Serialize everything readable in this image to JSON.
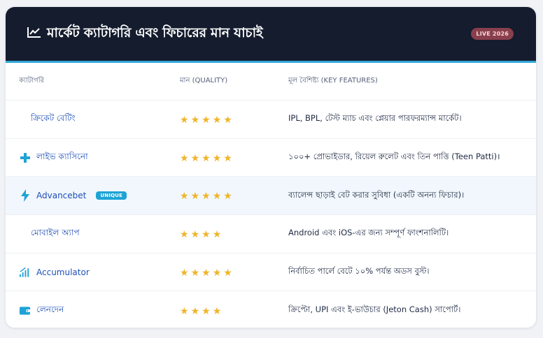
{
  "header": {
    "title": "মার্কেট ক্যাটাগরি এবং ফিচারের মান যাচাই",
    "badge": "LIVE 2026"
  },
  "columns": {
    "category": "ক্যাটাগরি",
    "quality": "মান (QUALITY)",
    "features": "মূল বৈশিষ্ট্য (KEY FEATURES)"
  },
  "rows": [
    {
      "category": "ক্রিকেট বেটিং",
      "icon": "none",
      "stars": 5,
      "feature": "IPL, BPL, টেস্ট ম্যাচ এবং প্লেয়ার পারফরম্যান্স মার্কেট।"
    },
    {
      "category": "লাইভ ক্যাসিনো",
      "icon": "plus-icon",
      "stars": 5,
      "feature": "১০০+ প্রোভাইডার, রিয়েল রুলেট এবং তিন পাত্তি (Teen Patti)।"
    },
    {
      "category": "Advancebet",
      "icon": "bolt-icon",
      "badge": "UNIQUE",
      "stars": 5,
      "feature": "ব্যালেন্স ছাড়াই বেট করার সুবিধা (একটি অনন্য ফিচার)।"
    },
    {
      "category": "মোবাইল অ্যাপ",
      "icon": "none",
      "stars": 4,
      "feature": "Android এবং iOS-এর জন্য সম্পূর্ণ ফাংশনালিটি।"
    },
    {
      "category": "Accumulator",
      "icon": "chart-bars-icon",
      "stars": 5,
      "feature": "নির্বাচিত পার্লে বেটে ১০% পর্যন্ত অডস বুস্ট।"
    },
    {
      "category": "লেনদেন",
      "icon": "wallet-icon",
      "stars": 4,
      "feature": "ক্রিপ্টো, UPI এবং ই-ভাউচার (Jeton Cash) সাপোর্ট।"
    }
  ],
  "colors": {
    "header_bg": "#141c2e",
    "accent": "#31a8d8",
    "link": "#1f4fb8",
    "star": "#f0b428",
    "badge_live": "#8a3f4c",
    "badge_unique": "#1ea3d6"
  }
}
